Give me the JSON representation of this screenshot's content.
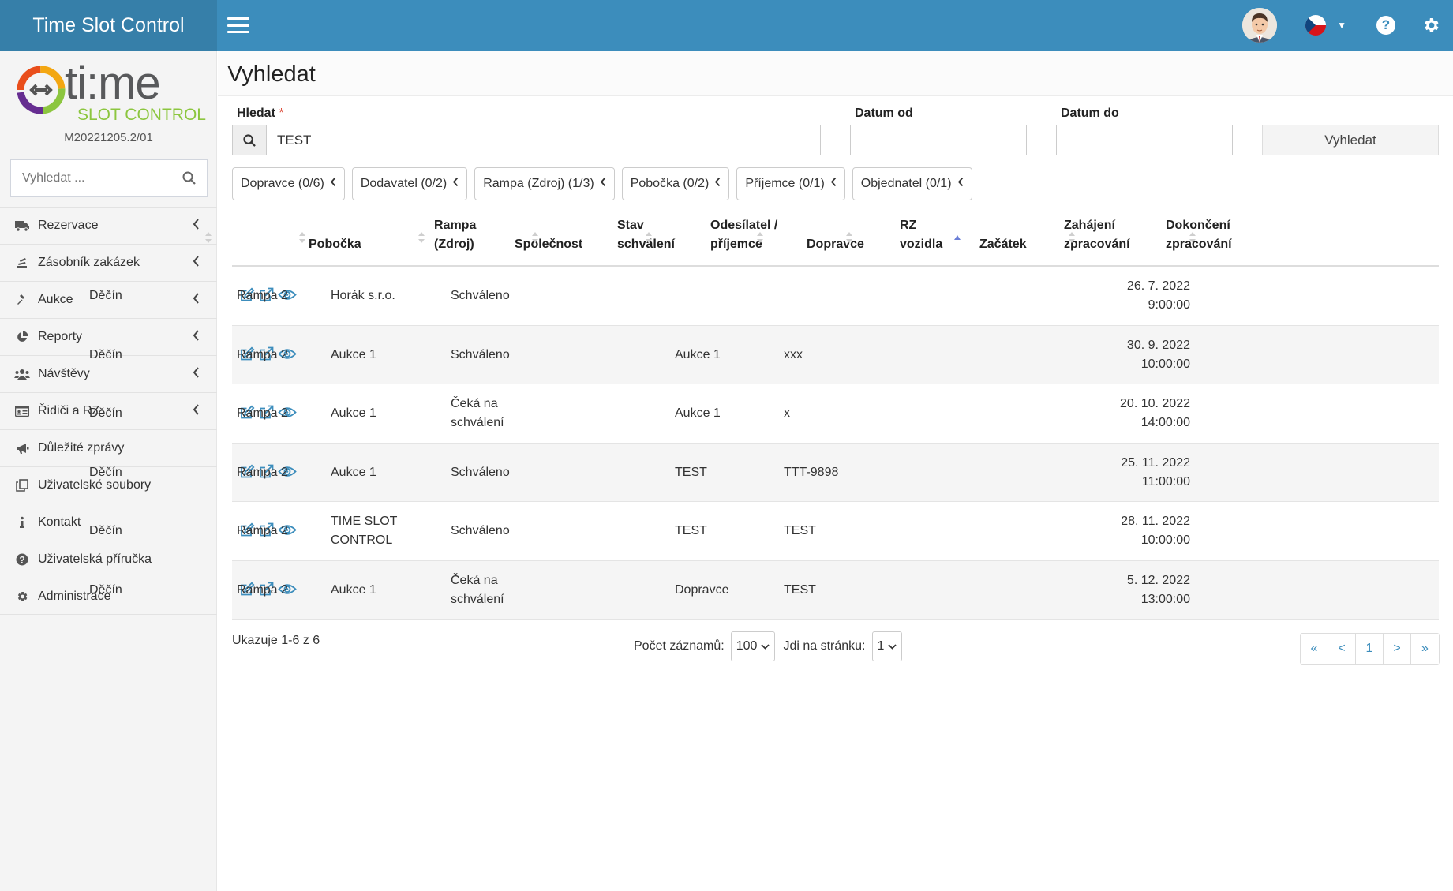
{
  "app": {
    "title": "Time Slot Control",
    "version": "M20221205.2/01"
  },
  "logo": {
    "wordmark": "ti:me",
    "subtitle": "SLOT CONTROL"
  },
  "colors": {
    "header": "#3c8dbc",
    "brand_bg": "#367fa9",
    "link": "#3c8dbc"
  },
  "sidebar": {
    "search_placeholder": "Vyhledat ...",
    "items": [
      {
        "label": "Rezervace",
        "icon": "truck-icon",
        "expandable": true
      },
      {
        "label": "Zásobník zakázek",
        "icon": "stack-icon",
        "expandable": true
      },
      {
        "label": "Aukce",
        "icon": "gavel-icon",
        "expandable": true
      },
      {
        "label": "Reporty",
        "icon": "pie-chart-icon",
        "expandable": true
      },
      {
        "label": "Návštěvy",
        "icon": "users-icon",
        "expandable": true
      },
      {
        "label": "Řidiči a RZ",
        "icon": "id-card-icon",
        "expandable": true
      },
      {
        "label": "Důležité zprávy",
        "icon": "megaphone-icon",
        "expandable": false
      },
      {
        "label": "Uživatelské soubory",
        "icon": "copy-icon",
        "expandable": false
      },
      {
        "label": "Kontakt",
        "icon": "info-icon",
        "expandable": false
      },
      {
        "label": "Uživatelská příručka",
        "icon": "question-icon",
        "expandable": false
      },
      {
        "label": "Administrace",
        "icon": "gear-icon",
        "expandable": false
      }
    ]
  },
  "page": {
    "title": "Vyhledat"
  },
  "form": {
    "search_label": "Hledat",
    "required_mark": "*",
    "search_value": "TEST",
    "date_from_label": "Datum od",
    "date_to_label": "Datum do",
    "date_from_value": "",
    "date_to_value": "",
    "submit_label": "Vyhledat"
  },
  "filters": [
    "Dopravce (0/6)",
    "Dodavatel (0/2)",
    "Rampa (Zdroj) (1/3)",
    "Pobočka (0/2)",
    "Příjemce (0/1)",
    "Objednatel (0/1)"
  ],
  "table": {
    "columns": [
      {
        "label": "Pobočka"
      },
      {
        "label": "Rampa (Zdroj)"
      },
      {
        "label": "Společnost"
      },
      {
        "label": "Stav schválení"
      },
      {
        "label": "Odesílatel / příjemce"
      },
      {
        "label": "Dopravce"
      },
      {
        "label": "RZ vozidla"
      },
      {
        "label": "Začátek",
        "sorted": "asc"
      },
      {
        "label": "Zahájení zpracování"
      },
      {
        "label": "Dokončení zpracování"
      }
    ],
    "rows": [
      {
        "pobocka": "Děčín",
        "rampa": "Rampa 2",
        "spolecnost": "Horák s.r.o.",
        "stav": "Schváleno",
        "odesilatel": "",
        "dopravce": "",
        "rz": "",
        "zacatek_date": "26. 7. 2022",
        "zacatek_time": "9:00:00",
        "zahajeni": "",
        "dokonceni": ""
      },
      {
        "pobocka": "Děčín",
        "rampa": "Rampa 2",
        "spolecnost": "Aukce 1",
        "stav": "Schváleno",
        "odesilatel": "",
        "dopravce": "Aukce 1",
        "rz": "xxx",
        "zacatek_date": "30. 9. 2022",
        "zacatek_time": "10:00:00",
        "zahajeni": "",
        "dokonceni": ""
      },
      {
        "pobocka": "Děčín",
        "rampa": "Rampa 2",
        "spolecnost": "Aukce 1",
        "stav": "Čeká na schválení",
        "odesilatel": "",
        "dopravce": "Aukce 1",
        "rz": "x",
        "zacatek_date": "20. 10. 2022",
        "zacatek_time": "14:00:00",
        "zahajeni": "",
        "dokonceni": ""
      },
      {
        "pobocka": "Děčín",
        "rampa": "Rampa 2",
        "spolecnost": "Aukce 1",
        "stav": "Schváleno",
        "odesilatel": "",
        "dopravce": "TEST",
        "rz": "TTT-9898",
        "zacatek_date": "25. 11. 2022",
        "zacatek_time": "11:00:00",
        "zahajeni": "",
        "dokonceni": ""
      },
      {
        "pobocka": "Děčín",
        "rampa": "Rampa 2",
        "spolecnost": "TIME SLOT CONTROL",
        "stav": "Schváleno",
        "odesilatel": "",
        "dopravce": "TEST",
        "rz": "TEST",
        "zacatek_date": "28. 11. 2022",
        "zacatek_time": "10:00:00",
        "zahajeni": "",
        "dokonceni": ""
      },
      {
        "pobocka": "Děčín",
        "rampa": "Rampa 2",
        "spolecnost": "Aukce 1",
        "stav": "Čeká na schválení",
        "odesilatel": "",
        "dopravce": "Dopravce",
        "rz": "TEST",
        "zacatek_date": "5. 12. 2022",
        "zacatek_time": "13:00:00",
        "zahajeni": "",
        "dokonceni": ""
      }
    ]
  },
  "footer": {
    "showing": "Ukazuje 1-6 z 6",
    "per_page_label": "Počet záznamů:",
    "per_page_value": "100",
    "goto_label": "Jdi na stránku:",
    "goto_value": "1",
    "pager": [
      "«",
      "<",
      "1",
      ">",
      "»"
    ]
  }
}
